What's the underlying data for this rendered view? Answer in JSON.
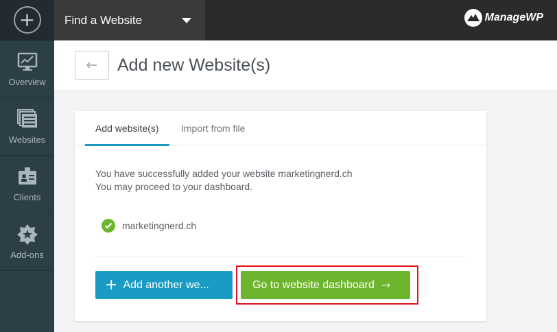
{
  "topbar": {
    "find_label": "Find a Website",
    "logo_text": "ManageWP"
  },
  "sidebar": {
    "items": [
      {
        "label": "Overview",
        "icon": "monitor-chart-icon"
      },
      {
        "label": "Websites",
        "icon": "stack-icon"
      },
      {
        "label": "Clients",
        "icon": "id-badge-icon"
      },
      {
        "label": "Add-ons",
        "icon": "badge-star-icon"
      }
    ]
  },
  "header": {
    "back_icon": "arrow-left",
    "title": "Add new Website(s)"
  },
  "card": {
    "tabs": [
      {
        "label": "Add website(s)",
        "active": true
      },
      {
        "label": "Import from file",
        "active": false
      }
    ],
    "message_line1": "You have successfully added your website marketingnerd.ch",
    "message_line2": "You may proceed to your dashboard.",
    "site": "marketingnerd.ch",
    "add_button_label": "Add another we...",
    "go_button_label": "Go to website dashboard",
    "go_button_arrow": "→"
  },
  "colors": {
    "blue": "#1a9bc4",
    "green": "#6eb52e",
    "highlight": "#e0101a",
    "sidebar": "#2c3e46"
  }
}
